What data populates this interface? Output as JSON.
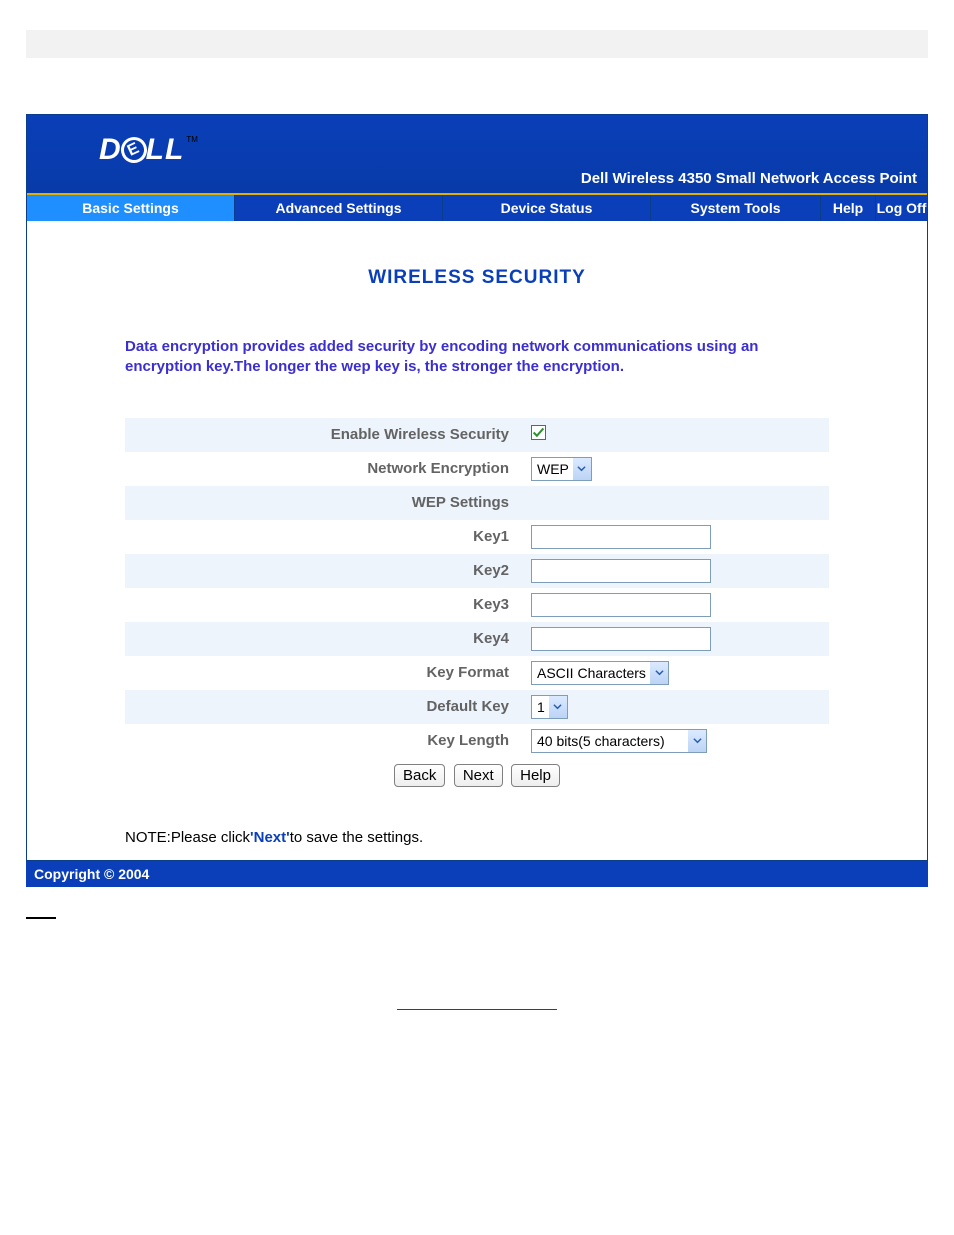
{
  "logo": {
    "brand": "DELL",
    "tm": "TM"
  },
  "product_title": "Dell Wireless 4350 Small Network Access Point",
  "nav": {
    "basic": "Basic Settings",
    "advanced": "Advanced Settings",
    "device": "Device Status",
    "system": "System Tools",
    "help": "Help",
    "logoff": "Log Off"
  },
  "page_title": "WIRELESS SECURITY",
  "description": "Data encryption provides added security by encoding network communications using an encryption key.The longer the wep key is, the stronger the encryption.",
  "form": {
    "enable_label": "Enable Wireless Security",
    "enable_checked": true,
    "net_enc_label": "Network Encryption",
    "net_enc_value": "WEP",
    "wep_settings_label": "WEP Settings",
    "key1_label": "Key1",
    "key1_value": "",
    "key2_label": "Key2",
    "key2_value": "",
    "key3_label": "Key3",
    "key3_value": "",
    "key4_label": "Key4",
    "key4_value": "",
    "key_format_label": "Key Format",
    "key_format_value": "ASCII Characters",
    "default_key_label": "Default Key",
    "default_key_value": "1",
    "key_length_label": "Key Length",
    "key_length_value": "40 bits(5 characters)"
  },
  "buttons": {
    "back": "Back",
    "next": "Next",
    "help": "Help"
  },
  "note": {
    "prefix": "NOTE:Please click",
    "link": "'Next'",
    "suffix": "to save the settings."
  },
  "footer": "Copyright © 2004"
}
